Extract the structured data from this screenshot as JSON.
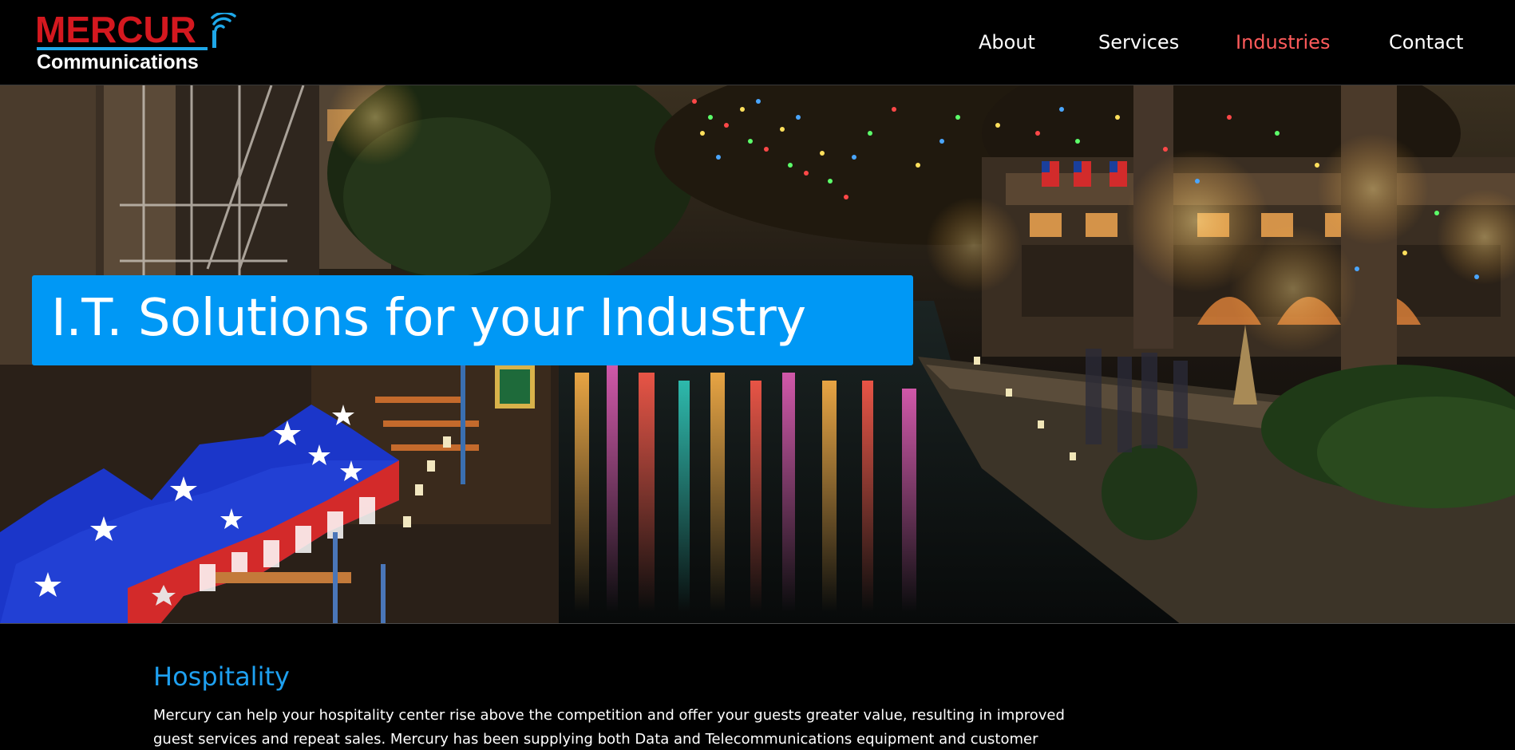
{
  "brand": {
    "logo_top": "MERCUR",
    "logo_bottom": "Communications",
    "colors": {
      "logo_red": "#d4181f",
      "logo_blue": "#1ea7e8"
    }
  },
  "nav": {
    "items": [
      {
        "label": "About",
        "active": false
      },
      {
        "label": "Services",
        "active": false
      },
      {
        "label": "Industries",
        "active": true
      },
      {
        "label": "Contact",
        "active": false
      }
    ],
    "colors": {
      "default": "#ffffff",
      "active": "#ff5b5b"
    }
  },
  "hero": {
    "title": "I.T. Solutions for your Industry",
    "title_box_color": "#0098f5",
    "image_description_icon": "river-walk-night-photo"
  },
  "section": {
    "heading": "Hospitality",
    "body": "Mercury can help your hospitality center rise above the competition and offer your guests greater value, resulting in improved guest services and repeat sales. Mercury has been supplying both Data and Telecommunications equipment and customer service",
    "heading_color": "#1ea0f0"
  }
}
